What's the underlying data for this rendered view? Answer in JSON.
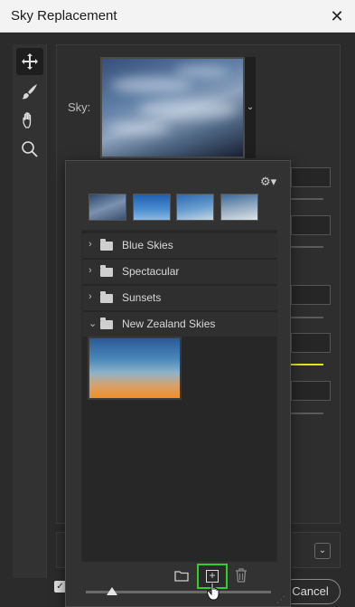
{
  "window": {
    "title": "Sky Replacement",
    "close_glyph": "✕"
  },
  "tools": [
    {
      "name": "move-tool",
      "icon": "move-icon",
      "active": true
    },
    {
      "name": "sky-brush-tool",
      "icon": "brush-icon",
      "active": false
    },
    {
      "name": "hand-tool",
      "icon": "hand-icon",
      "active": false
    },
    {
      "name": "zoom-tool",
      "icon": "magnifier-icon",
      "active": false
    }
  ],
  "sky": {
    "label": "Sky:",
    "dropdown_glyph": "⌄"
  },
  "preset_picker": {
    "gear_glyph": "⚙▾",
    "folders": [
      {
        "label": "Blue Skies",
        "expanded": false
      },
      {
        "label": "Spectacular",
        "expanded": false
      },
      {
        "label": "Sunsets",
        "expanded": false
      },
      {
        "label": "New Zealand Skies",
        "expanded": true
      }
    ],
    "new_preset_glyph": "+",
    "slider_value": 0.14
  },
  "footer": {
    "cancel_label": "Cancel",
    "checkbox_glyph": "✓",
    "select_glyph": "⌄"
  },
  "colors": {
    "highlight": "#2ecf2e",
    "accent_yellow": "#e8e22a"
  }
}
